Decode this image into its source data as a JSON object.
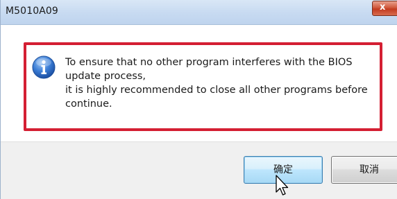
{
  "window": {
    "title": "M5010A09",
    "close_glyph": "x"
  },
  "dialog": {
    "icon": "info-icon",
    "message_lines": [
      "To ensure that no other program interferes with the BIOS",
      "update process,",
      "it is highly recommended to close all other programs before",
      "continue."
    ]
  },
  "buttons": {
    "ok_label": "确定",
    "cancel_label": "取消"
  },
  "colors": {
    "highlight_frame": "#d41f33",
    "titlebar": "#c7daf1",
    "ok_button_border": "#3c7fb1"
  }
}
